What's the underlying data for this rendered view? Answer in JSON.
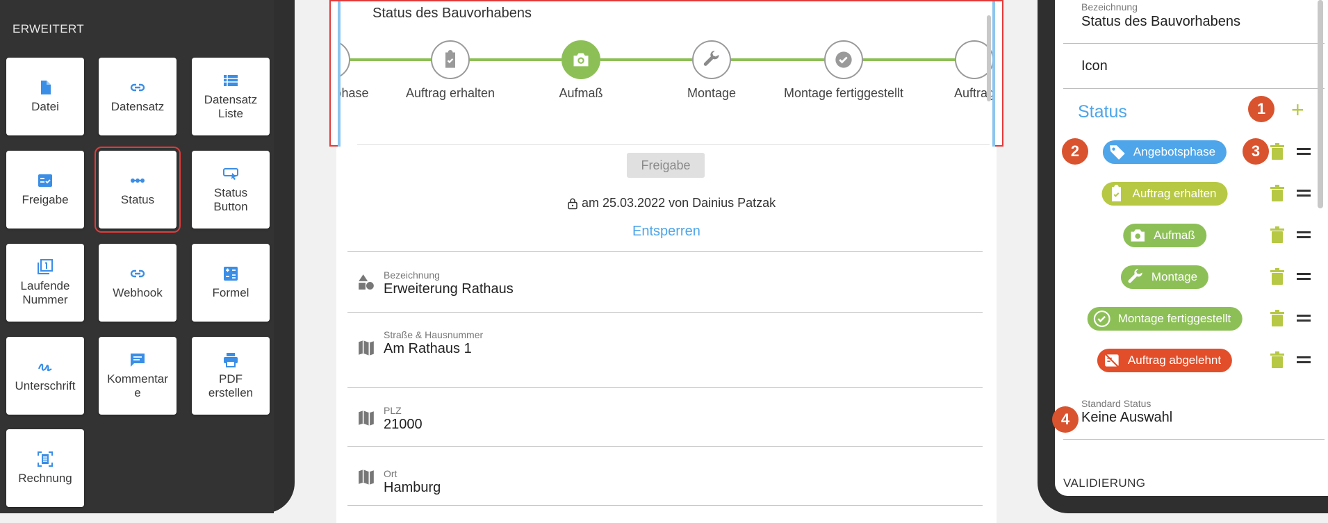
{
  "left_panel": {
    "section_label": "ERWEITERT",
    "tiles": [
      {
        "label": "Datei",
        "icon": "file-icon"
      },
      {
        "label": "Datensatz",
        "icon": "link-icon"
      },
      {
        "label": "Datensatz\nListe",
        "icon": "list-icon"
      },
      {
        "label": "Freigabe",
        "icon": "checklist-icon"
      },
      {
        "label": "Status",
        "icon": "status-dots-icon"
      },
      {
        "label": "Status\nButton",
        "icon": "status-button-icon"
      },
      {
        "label": "Laufende\nNummer",
        "icon": "counter-icon"
      },
      {
        "label": "Webhook",
        "icon": "link-icon"
      },
      {
        "label": "Formel",
        "icon": "calculator-icon"
      },
      {
        "label": "Unterschrift",
        "icon": "signature-icon"
      },
      {
        "label": "Kommentar\ne",
        "icon": "comment-icon"
      },
      {
        "label": "PDF\nerstellen",
        "icon": "printer-icon"
      },
      {
        "label": "Rechnung",
        "icon": "invoice-icon"
      }
    ]
  },
  "status_preview": {
    "title": "Status des Bauvorhabens",
    "steps": [
      {
        "label": "phase"
      },
      {
        "label": "Auftrag erhalten",
        "icon": "clipboard-check-icon"
      },
      {
        "label": "Aufmaß",
        "icon": "camera-icon",
        "active": true
      },
      {
        "label": "Montage",
        "icon": "wrench-icon"
      },
      {
        "label": "Montage fertiggestellt",
        "icon": "check-circle-icon"
      },
      {
        "label": "Auftrag"
      }
    ]
  },
  "approval": {
    "button_label": "Freigabe",
    "lock_text": "am 25.03.2022 von Dainius Patzak",
    "unlock_label": "Entsperren"
  },
  "fields": [
    {
      "label": "Bezeichnung",
      "value": "Erweiterung Rathaus",
      "icon": "shapes-icon"
    },
    {
      "label": "Straße & Hausnummer",
      "value": "Am Rathaus 1",
      "icon": "map-icon"
    },
    {
      "label": "PLZ",
      "value": "21000",
      "icon": "map-icon"
    },
    {
      "label": "Ort",
      "value": "Hamburg",
      "icon": "map-icon"
    }
  ],
  "right_panel": {
    "name_label": "Bezeichnung",
    "name_value": "Status des Bauvorhabens",
    "icon_label": "Icon",
    "status_title": "Status",
    "add_label": "+",
    "statuses": [
      {
        "label": "Angebotsphase",
        "color": "#4ea5e9",
        "icon": "tag-icon"
      },
      {
        "label": "Auftrag erhalten",
        "color": "#b7c844",
        "icon": "clipboard-check-icon"
      },
      {
        "label": "Aufmaß",
        "color": "#8dbf57",
        "icon": "camera-icon"
      },
      {
        "label": "Montage",
        "color": "#8dbf57",
        "icon": "wrench-icon"
      },
      {
        "label": "Montage fertiggestellt",
        "color": "#8dbf57",
        "icon": "check-circle-icon"
      },
      {
        "label": "Auftrag abgelehnt",
        "color": "#e24e2a",
        "icon": "cancel-doc-icon"
      }
    ],
    "default_label": "Standard Status",
    "default_value": "Keine Auswahl",
    "validation_label": "VALIDIERUNG"
  },
  "badges": [
    "1",
    "2",
    "3",
    "4"
  ],
  "colors": {
    "accent_blue": "#4ea5e9",
    "green": "#8dbf57",
    "lime": "#b7c844",
    "red_highlight": "#e23a3a",
    "badge": "#d9532f",
    "dark_device": "#2f2f2f"
  }
}
